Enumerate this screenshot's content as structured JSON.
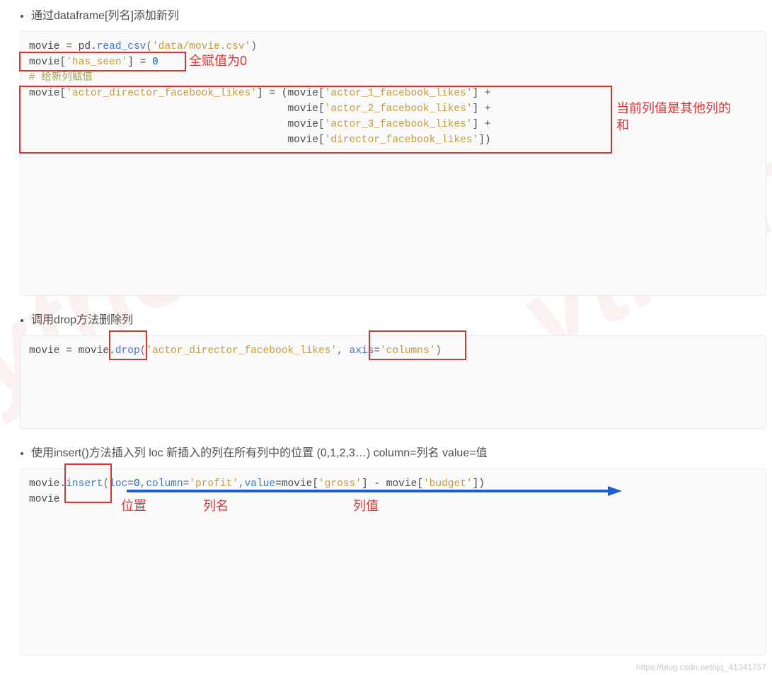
{
  "bullet1": "通过dataframe[列名]添加新列",
  "bullet2": "调用drop方法删除列",
  "bullet3": "使用insert()方法插入列 loc 新插入的列在所有列中的位置  (0,1,2,3…) column=列名 value=值",
  "code1": {
    "l1a": "movie ",
    "l1b": "=",
    "l1c": " pd.",
    "l1d": "read_csv",
    "l1e": "(",
    "l1f": "'data/movie.csv'",
    "l1g": ")",
    "l2a": "movie[",
    "l2b": "'has_seen'",
    "l2c": "] = ",
    "l2d": "0",
    "l3": "# 给新列赋值",
    "l4a": "movie[",
    "l4b": "'actor_director_facebook_likes'",
    "l4c": "] = (movie[",
    "l4d": "'actor_1_facebook_likes'",
    "l4e": "] +",
    "l5a": "                                          movie[",
    "l5b": "'actor_2_facebook_likes'",
    "l5c": "] +",
    "l6a": "                                          movie[",
    "l6b": "'actor_3_facebook_likes'",
    "l6c": "] +",
    "l7a": "                                          movie[",
    "l7b": "'director_facebook_likes'",
    "l7c": "])"
  },
  "code2": {
    "a": "movie ",
    "b": "=",
    "c": " movie.",
    "d": "drop",
    "e": "(",
    "f": "'actor_director_facebook_likes'",
    "g": ", ",
    "h": "axis",
    "i": "=",
    "j": "'columns'",
    "k": ")"
  },
  "code3": {
    "a": "movie.",
    "b": "insert",
    "c": "(",
    "d": "loc",
    "e": "=",
    "f": "0",
    "g": ",",
    "h": "column",
    "i": "=",
    "j": "'profit'",
    "k": ",",
    "l": "value",
    "m": "=movie[",
    "n": "'gross'",
    "o": "] - movie[",
    "p": "'budget'",
    "q": "])",
    "line2": "movie"
  },
  "anno": {
    "a1": "全赋值为0",
    "a2a": "当前列值是其他列的",
    "a2b": "和",
    "a3": "位置",
    "a4": "列名",
    "a5": "列值"
  },
  "wm_text": "ython",
  "small_wm": "https://blog.csdn.net/qq_41341757"
}
